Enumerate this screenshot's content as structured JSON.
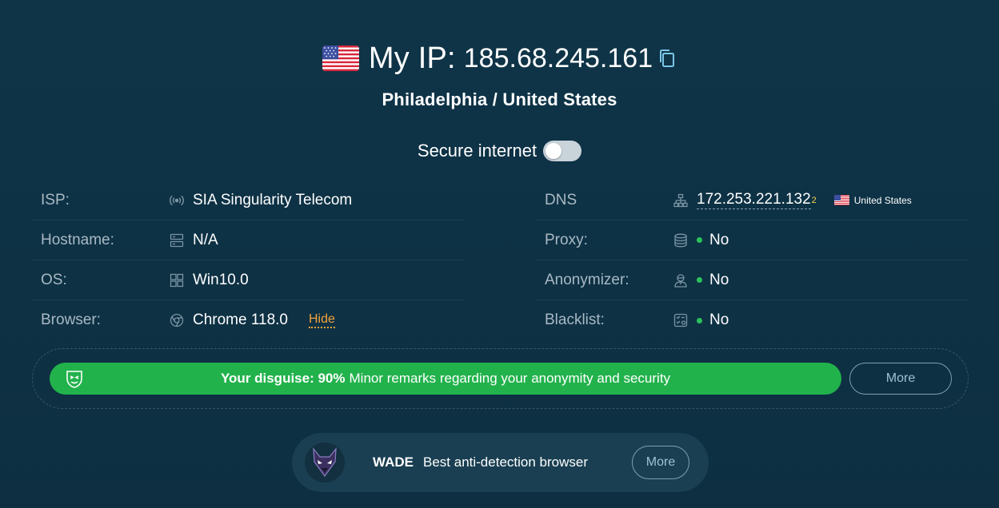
{
  "header": {
    "ip_label": "My IP:",
    "ip_value": "185.68.245.161",
    "location": "Philadelphia / United States"
  },
  "secure": {
    "label": "Secure internet",
    "enabled": false
  },
  "left_rows": [
    {
      "label": "ISP:",
      "icon": "signal-icon",
      "value": "SIA Singularity Telecom"
    },
    {
      "label": "Hostname:",
      "icon": "server-icon",
      "value": "N/A"
    },
    {
      "label": "OS:",
      "icon": "windows-icon",
      "value": "Win10.0"
    },
    {
      "label": "Browser:",
      "icon": "browser-icon",
      "value": "Chrome 118.0",
      "action": "Hide"
    }
  ],
  "right_rows": [
    {
      "label": "DNS",
      "icon": "network-icon",
      "value": "172.253.221.132",
      "sup": "2",
      "country": "United States"
    },
    {
      "label": "Proxy:",
      "icon": "database-icon",
      "value": "No",
      "status_color": "#2ac35b"
    },
    {
      "label": "Anonymizer:",
      "icon": "user-mask-icon",
      "value": "No",
      "status_color": "#2ac35b"
    },
    {
      "label": "Blacklist:",
      "icon": "list-check-icon",
      "value": "No",
      "status_color": "#2ac35b"
    }
  ],
  "disguise": {
    "label_bold": "Your disguise: 90%",
    "label_rest": "Minor remarks regarding your anonymity and security",
    "more": "More",
    "color": "#22b24c"
  },
  "promo": {
    "brand": "WADE",
    "text": "Best anti-detection browser",
    "more": "More"
  },
  "colors": {
    "accent_orange": "#f0a33d",
    "status_green": "#2ac35b",
    "background": "#0f3448"
  }
}
